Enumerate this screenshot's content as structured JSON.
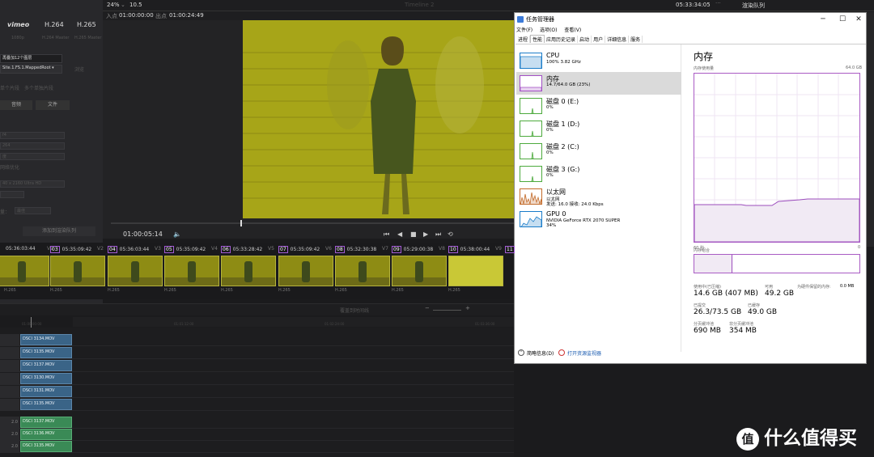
{
  "render": {
    "formats": [
      "vimeo",
      "H.264",
      "H.265"
    ],
    "format_sub": [
      "1080p",
      "H.264 Master",
      "H.265 Master"
    ],
    "filename": "再叠加12个图层",
    "location": "Site.1.FS.1.MappedRoot ▾",
    "browse": "浏览",
    "single_clip": "单个片段",
    "multi_clip": "多个单独片段",
    "video_tab": "音频",
    "file_tab": "文件",
    "dd1": "f4",
    "dd2": "264",
    "dd3": "度",
    "dd4_label": "网络优化",
    "dd5": "40 x 2160 Ultra HD",
    "quality_label": "量：",
    "quality_value": "最佳",
    "add_queue": "添加到渲染队列"
  },
  "topbar": {
    "zoom": "24%",
    "fps": "10.5",
    "timeline_name": "Timeline 2",
    "in_label": "入点",
    "in_tc": "01:00:00:00",
    "out_label": "出点",
    "out_tc": "01:00:24:49",
    "right_tc": "05:33:34:05",
    "render_queue": "渲染队列"
  },
  "viewer": {
    "timecode": "01:00:05:14"
  },
  "clips": [
    {
      "num": "",
      "tc": "05:36:03:44",
      "track": "V1",
      "codec": "H.265"
    },
    {
      "num": "03",
      "tc": "05:35:09:42",
      "track": "V2",
      "codec": "H.265"
    },
    {
      "num": "04",
      "tc": "05:36:03:44",
      "track": "V3",
      "codec": "H.265"
    },
    {
      "num": "05",
      "tc": "05:35:09:42",
      "track": "V4",
      "codec": "H.265"
    },
    {
      "num": "06",
      "tc": "05:33:28:42",
      "track": "V5",
      "codec": "H.265"
    },
    {
      "num": "07",
      "tc": "05:35:09:42",
      "track": "V6",
      "codec": "H.265"
    },
    {
      "num": "08",
      "tc": "05:32:30:38",
      "track": "V7",
      "codec": "H.265"
    },
    {
      "num": "09",
      "tc": "05:29:00:38",
      "track": "V8",
      "codec": "H.265"
    },
    {
      "num": "10",
      "tc": "05:38:00:44",
      "track": "V9",
      "codec": "H.265"
    },
    {
      "num": "11",
      "tc": "",
      "track": "V10",
      "codec": ""
    }
  ],
  "timeline": {
    "mode": "覆盖到时间线",
    "ruler_marks": [
      "01:00:00:00",
      "01:01:12:00",
      "01:02:24:00",
      "01:03:36:00"
    ],
    "video_tracks": [
      "DSCI 3134.MOV",
      "DSCI 3135.MOV",
      "DSCI 3137.MOV",
      "DSCI 3130.MOV",
      "DSCI 3131.MOV",
      "DSCI 3135.MOV"
    ],
    "audio_tracks": [
      {
        "level": "2.0",
        "name": "DSCI 3137.MOV"
      },
      {
        "level": "2.0",
        "name": "DSCI 3136.MOV"
      },
      {
        "level": "2.0",
        "name": "DSCI 3135.MOV"
      }
    ]
  },
  "taskmgr": {
    "title": "任务管理器",
    "menu": [
      "文件(F)",
      "选项(O)",
      "查看(V)"
    ],
    "tabs": [
      "进程",
      "性能",
      "应用历史记录",
      "启动",
      "用户",
      "详细信息",
      "服务"
    ],
    "active_tab": "性能",
    "resources": [
      {
        "name": "CPU",
        "d1": "100% 3.82 GHz",
        "d2": "",
        "d3": "",
        "color": "#1a7cc9"
      },
      {
        "name": "内存",
        "d1": "14.7/64.0 GB (23%)",
        "d2": "",
        "d3": "",
        "color": "#a24fc4"
      },
      {
        "name": "磁盘 0 (E:)",
        "d1": "0%",
        "d2": "",
        "d3": "",
        "color": "#4daa3d"
      },
      {
        "name": "磁盘 1 (D:)",
        "d1": "0%",
        "d2": "",
        "d3": "",
        "color": "#4daa3d"
      },
      {
        "name": "磁盘 2 (C:)",
        "d1": "0%",
        "d2": "",
        "d3": "",
        "color": "#4daa3d"
      },
      {
        "name": "磁盘 3 (G:)",
        "d1": "0%",
        "d2": "",
        "d3": "",
        "color": "#4daa3d"
      },
      {
        "name": "以太网",
        "d1": "以太网",
        "d2": "发送: 16.0 接收: 24.0 Kbps",
        "d3": "",
        "color": "#c36b2a"
      },
      {
        "name": "GPU 0",
        "d1": "NVIDIA GeForce RTX 2070 SUPER",
        "d2": "34%",
        "d3": "",
        "color": "#1a7cc9"
      }
    ],
    "memory": {
      "heading": "内存",
      "usage_label": "内存使用量",
      "max_label": "64.0 GB",
      "left_axis": "60 秒",
      "right_axis": "0",
      "composition_label": "内存组合",
      "in_use_label": "使用中(已压缩)",
      "in_use": "14.6 GB (407 MB)",
      "available_label": "可用",
      "available": "49.2 GB",
      "hw_reserved_label": "为硬件保留的内存:",
      "hw_reserved": "0.0 MB",
      "committed_label": "已提交",
      "committed": "26.3/73.5 GB",
      "cached_label": "已缓存",
      "cached": "49.0 GB",
      "paged_label": "分页缓冲池",
      "paged": "690 MB",
      "nonpaged_label": "非分页缓冲池",
      "nonpaged": "354 MB",
      "usage_fraction": 0.23
    },
    "footer_less": "简略信息(D)",
    "footer_monitor": "打开资源监视器"
  },
  "watermark": {
    "symbol": "值",
    "text": "什么值得买"
  }
}
